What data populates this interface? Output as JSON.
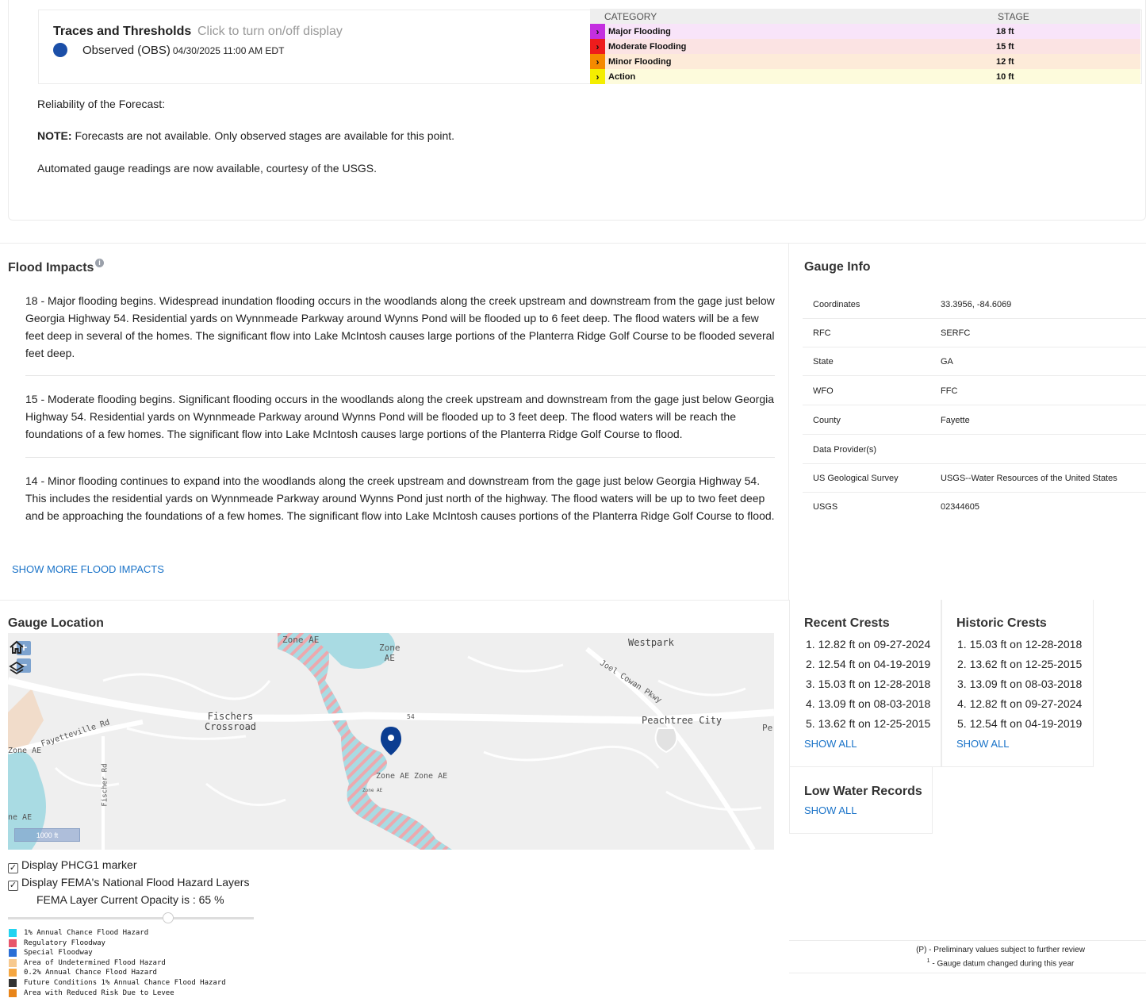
{
  "traces": {
    "title": "Traces and Thresholds",
    "hint": "Click to turn on/off display",
    "observed_label": "Observed (OBS)",
    "observed_time": "04/30/2025 11:00 AM EDT",
    "observed_color": "#1b4fa8"
  },
  "thresholds": {
    "header_category": "CATEGORY",
    "header_stage": "STAGE",
    "rows": [
      {
        "category": "Major Flooding",
        "stage": "18 ft",
        "color": "#c42fe0"
      },
      {
        "category": "Moderate Flooding",
        "stage": "15 ft",
        "color": "#ee1c1c"
      },
      {
        "category": "Minor Flooding",
        "stage": "12 ft",
        "color": "#f58a00"
      },
      {
        "category": "Action",
        "stage": "10 ft",
        "color": "#f4ee00"
      }
    ]
  },
  "notes": {
    "reliability": "Reliability of the Forecast:",
    "note_bold": "NOTE:",
    "note_text": " Forecasts are not available. Only observed stages are available for this point.",
    "automated": "Automated gauge readings are now available, courtesy of the USGS."
  },
  "impacts": {
    "title": "Flood Impacts",
    "items": [
      "18 - Major flooding begins. Widespread inundation flooding occurs in the woodlands along the creek upstream and downstream from the gage just below Georgia Highway 54. Residential yards on Wynnmeade Parkway around Wynns Pond will be flooded up to 6 feet deep. The flood waters will be a few feet deep in several of the homes. The significant flow into Lake McIntosh causes large portions of the Planterra Ridge Golf Course to be flooded several feet deep.",
      "15 - Moderate flooding begins. Significant flooding occurs in the woodlands along the creek upstream and downstream from the gage just below Georgia Highway 54. Residential yards on Wynnmeade Parkway around Wynns Pond will be flooded up to 3 feet deep. The flood waters will be reach the foundations of a few homes. The significant flow into Lake McIntosh causes large portions of the Planterra Ridge Golf Course to flood.",
      "14 - Minor flooding continues to expand into the woodlands along the creek upstream and downstream from the gage just below Georgia Highway 54. This includes the residential yards on Wynnmeade Parkway around Wynns Pond just north of the highway. The flood waters will be up to two feet deep and be approaching the foundations of a few homes. The significant flow into Lake McIntosh causes portions of the Planterra Ridge Golf Course to flood."
    ],
    "show_more": "SHOW MORE FLOOD IMPACTS"
  },
  "gauge_info": {
    "title": "Gauge Info",
    "rows": [
      {
        "label": "Coordinates",
        "value": "33.3956, -84.6069",
        "link": false
      },
      {
        "label": "RFC",
        "value": "SERFC",
        "link": true
      },
      {
        "label": "State",
        "value": "GA",
        "link": true
      },
      {
        "label": "WFO",
        "value": "FFC",
        "link": true
      },
      {
        "label": "County",
        "value": "Fayette",
        "link": false
      },
      {
        "label": "Data Provider(s)",
        "value": "",
        "link": false
      },
      {
        "label": "US Geological Survey",
        "value": "USGS--Water Resources of the United States",
        "link": true
      },
      {
        "label": "USGS",
        "value": "02344605",
        "link": true
      }
    ]
  },
  "location": {
    "title": "Gauge Location",
    "map_labels": {
      "zone_ae_top": "Zone AE",
      "zone_ae_upper": "Zone\nAE",
      "westpark": "Westpark",
      "joel_cowan": "Joel Cowan Pkwy",
      "fischers": "Fischers\nCrossroad",
      "route54": "54",
      "peachtree": "Peachtree City",
      "pe": "Pe",
      "fayetteville": "Fayetteville Rd",
      "zone_ae_left": "Zone AE",
      "fischer_rd": "Fischer Rd",
      "zone_ae_mid1": "Zone AE",
      "zone_ae_mid2": "Zone AE",
      "zone_ae_small": "Zone AE",
      "ne_ae": "ne AE",
      "scale": "1000 ft"
    },
    "zoom_in": "+",
    "zoom_out": "−",
    "display_marker": "Display PHCG1 marker",
    "display_fema": "Display FEMA's National Flood Hazard Layers",
    "opacity_text": "FEMA Layer Current Opacity is : 65 %",
    "opacity_value": 0.65,
    "legend": [
      {
        "label": "1% Annual Chance Flood Hazard",
        "color": "#22d3f0"
      },
      {
        "label": "Regulatory Floodway",
        "color": "#e8556a"
      },
      {
        "label": "Special Floodway",
        "color": "#2a6fd6"
      },
      {
        "label": "Area of Undetermined Flood Hazard",
        "color": "#f7c98f"
      },
      {
        "label": "0.2% Annual Chance Flood Hazard",
        "color": "#f5a742"
      },
      {
        "label": "Future Conditions 1% Annual Chance Flood Hazard",
        "color": "#333333"
      },
      {
        "label": "Area with Reduced Risk Due to Levee",
        "color": "#e8851a"
      }
    ]
  },
  "recent_crests": {
    "title": "Recent Crests",
    "items": [
      "1. 12.82 ft on 09-27-2024",
      "2. 12.54 ft on 04-19-2019",
      "3. 15.03 ft on 12-28-2018",
      "4. 13.09 ft on 08-03-2018",
      "5. 13.62 ft on 12-25-2015"
    ],
    "show_all": "SHOW ALL"
  },
  "historic_crests": {
    "title": "Historic Crests",
    "items": [
      "1. 15.03 ft on 12-28-2018",
      "2. 13.62 ft on 12-25-2015",
      "3. 13.09 ft on 08-03-2018",
      "4. 12.82 ft on 09-27-2024",
      "5. 12.54 ft on 04-19-2019"
    ],
    "show_all": "SHOW ALL"
  },
  "low_water": {
    "title": "Low Water Records",
    "show_all": "SHOW ALL"
  },
  "footnotes": {
    "preliminary": "(P) -  Preliminary values subject to further review",
    "datum_mark": "1",
    "datum": " -  Gauge datum changed during this year"
  }
}
